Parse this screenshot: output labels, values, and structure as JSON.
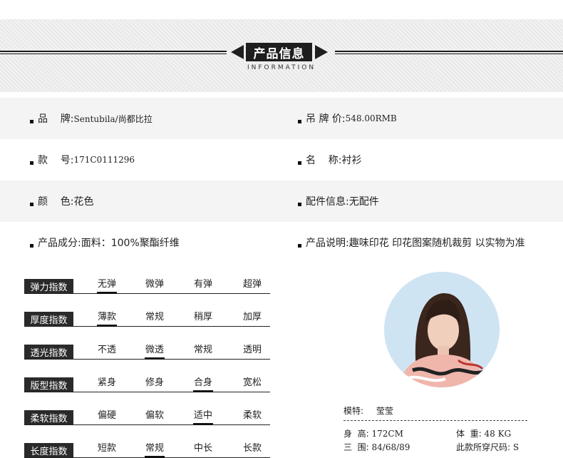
{
  "header": {
    "title": "产品信息",
    "subtitle": "INFORMATION"
  },
  "info_rows": [
    {
      "left": {
        "label": "品    牌:",
        "value": "Sentubila/尚都比拉"
      },
      "right": {
        "label": "吊 牌 价:",
        "value": "548.00RMB"
      }
    },
    {
      "left": {
        "label": "款    号:",
        "value": "171C0111296"
      },
      "right": {
        "label": "名    称:",
        "value": "衬衫"
      }
    },
    {
      "left": {
        "label": "颜    色:",
        "value": "花色"
      },
      "right": {
        "label": "配件信息:",
        "value": "无配件"
      }
    },
    {
      "left": {
        "label": "产品成分:",
        "value": "面料：100%聚酯纤维"
      },
      "right": {
        "label": "产品说明:",
        "value": "趣味印花 印花图案随机裁剪 以实物为准"
      }
    }
  ],
  "indices": [
    {
      "label": "弹力指数",
      "options": [
        "无弹",
        "微弹",
        "有弹",
        "超弹"
      ],
      "selected": 0
    },
    {
      "label": "厚度指数",
      "options": [
        "薄款",
        "常规",
        "稍厚",
        "加厚"
      ],
      "selected": 0
    },
    {
      "label": "透光指数",
      "options": [
        "不透",
        "微透",
        "常规",
        "透明"
      ],
      "selected": 1
    },
    {
      "label": "版型指数",
      "options": [
        "紧身",
        "修身",
        "合身",
        "宽松"
      ],
      "selected": 2
    },
    {
      "label": "柔软指数",
      "options": [
        "偏硬",
        "偏软",
        "适中",
        "柔软"
      ],
      "selected": 2
    },
    {
      "label": "长度指数",
      "options": [
        "短款",
        "常规",
        "中长",
        "长款"
      ],
      "selected": 1
    }
  ],
  "model": {
    "label": "模特:",
    "name": "莹莹",
    "height_label": "身  高:",
    "height": "172CM",
    "weight_label": "体  重:",
    "weight": "48 KG",
    "measure_label": "三  围:",
    "measure": "84/68/89",
    "size_label": "此款所穿尺码:",
    "size": "S"
  }
}
